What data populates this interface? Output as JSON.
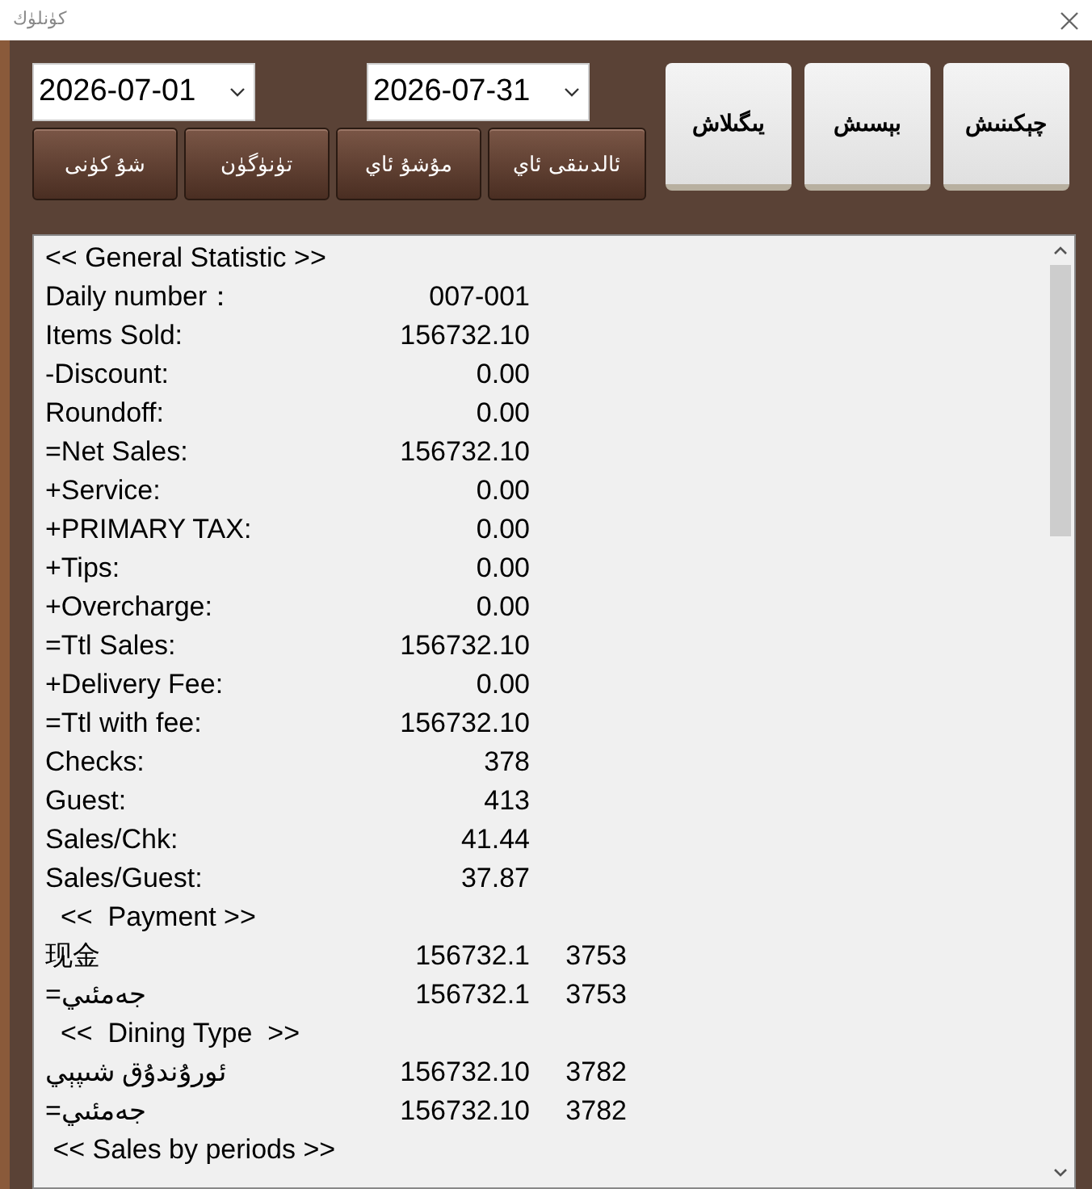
{
  "window": {
    "title": "كۈنلۈك"
  },
  "date_from": {
    "value": "2026-07-01"
  },
  "date_to": {
    "value": "2026-07-31"
  },
  "period_buttons": [
    "ئالدىنقى ئاي",
    "مۇشۇ ئاي",
    "تۈنۈگۈن",
    "شۇ كۈنى"
  ],
  "action_buttons": [
    "چېكىنىش",
    "بېسىش",
    "يىگىلاش"
  ],
  "report": [
    {
      "kind": "heading",
      "text": "<< General Statistic >>"
    },
    {
      "kind": "row",
      "label": "Daily number：",
      "value": "007-001"
    },
    {
      "kind": "row",
      "label": "Items Sold:",
      "value": "156732.10"
    },
    {
      "kind": "row",
      "label": "-Discount:",
      "value": "0.00"
    },
    {
      "kind": "row",
      "label": "Roundoff:",
      "value": "0.00"
    },
    {
      "kind": "row",
      "label": "=Net Sales:",
      "value": "156732.10"
    },
    {
      "kind": "row",
      "label": "+Service:",
      "value": "0.00"
    },
    {
      "kind": "row",
      "label": "+PRIMARY TAX:",
      "value": "0.00"
    },
    {
      "kind": "row",
      "label": "+Tips:",
      "value": "0.00"
    },
    {
      "kind": "row",
      "label": "+Overcharge:",
      "value": "0.00"
    },
    {
      "kind": "row",
      "label": "=Ttl Sales:",
      "value": "156732.10"
    },
    {
      "kind": "row",
      "label": "+Delivery Fee:",
      "value": "0.00"
    },
    {
      "kind": "row",
      "label": "=Ttl with fee:",
      "value": "156732.10"
    },
    {
      "kind": "row",
      "label": "Checks:",
      "value": "378"
    },
    {
      "kind": "row",
      "label": "Guest:",
      "value": "413"
    },
    {
      "kind": "row",
      "label": "Sales/Chk:",
      "value": "41.44"
    },
    {
      "kind": "row",
      "label": "Sales/Guest:",
      "value": "37.87"
    },
    {
      "kind": "heading",
      "text": "  <<  Payment >>"
    },
    {
      "kind": "row",
      "label": "现金",
      "value": "156732.1",
      "count": "3753"
    },
    {
      "kind": "row",
      "label": "=جەمئىي",
      "value": "156732.1",
      "count": "3753"
    },
    {
      "kind": "heading",
      "text": "  <<  Dining Type  >>"
    },
    {
      "kind": "row",
      "label": "ئورۇندۇق شىپېي",
      "value": "156732.10",
      "count": "3782"
    },
    {
      "kind": "row",
      "label": "=جەمئىي",
      "value": "156732.10",
      "count": "3782"
    },
    {
      "kind": "heading",
      "text": " << Sales by periods >>"
    }
  ]
}
